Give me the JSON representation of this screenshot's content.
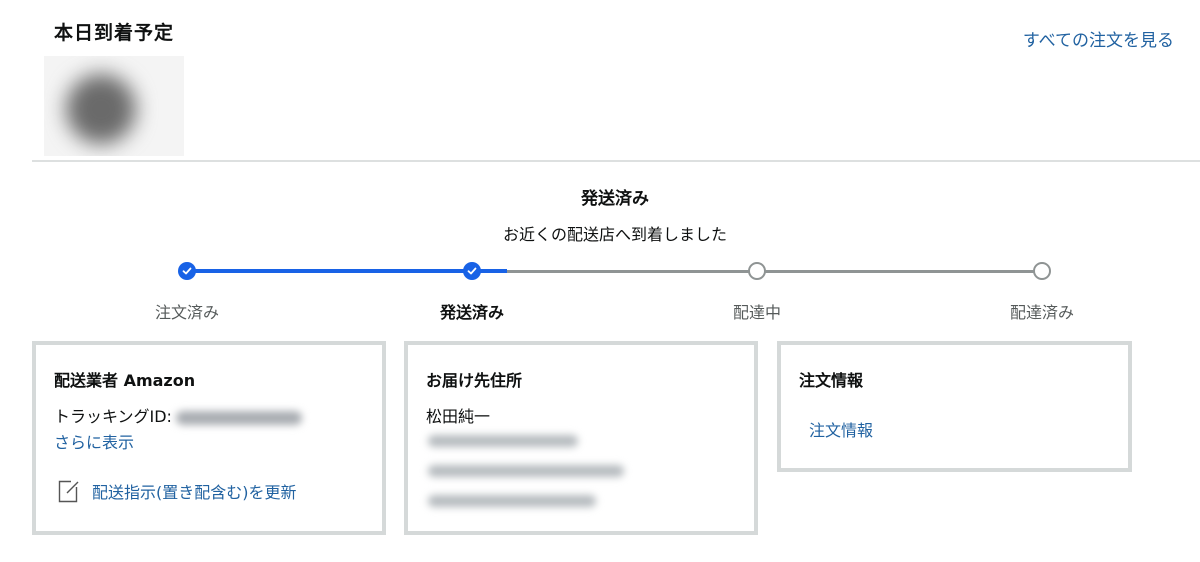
{
  "header": {
    "title": "本日到着予定",
    "all_orders_link": "すべての注文を見る"
  },
  "status": {
    "title": "発送済み",
    "subtitle": "お近くの配送店へ到着しました",
    "progress": 0.333,
    "steps": [
      {
        "label": "注文済み",
        "state": "done"
      },
      {
        "label": "発送済み",
        "state": "current"
      },
      {
        "label": "配達中",
        "state": "pending"
      },
      {
        "label": "配達済み",
        "state": "pending"
      }
    ]
  },
  "carrier_card": {
    "title": "配送業者 Amazon",
    "tracking_label": "トラッキングID:",
    "more_link": "さらに表示",
    "update_link": "配送指示(置き配含む)を更新"
  },
  "address_card": {
    "title": "お届け先住所",
    "name": "松田純一"
  },
  "order_card": {
    "title": "注文情報",
    "link": "注文情報"
  },
  "colors": {
    "accent": "#1862e6",
    "link": "#2162a1",
    "pending": "#8f9494",
    "border": "#d5d9d9"
  }
}
